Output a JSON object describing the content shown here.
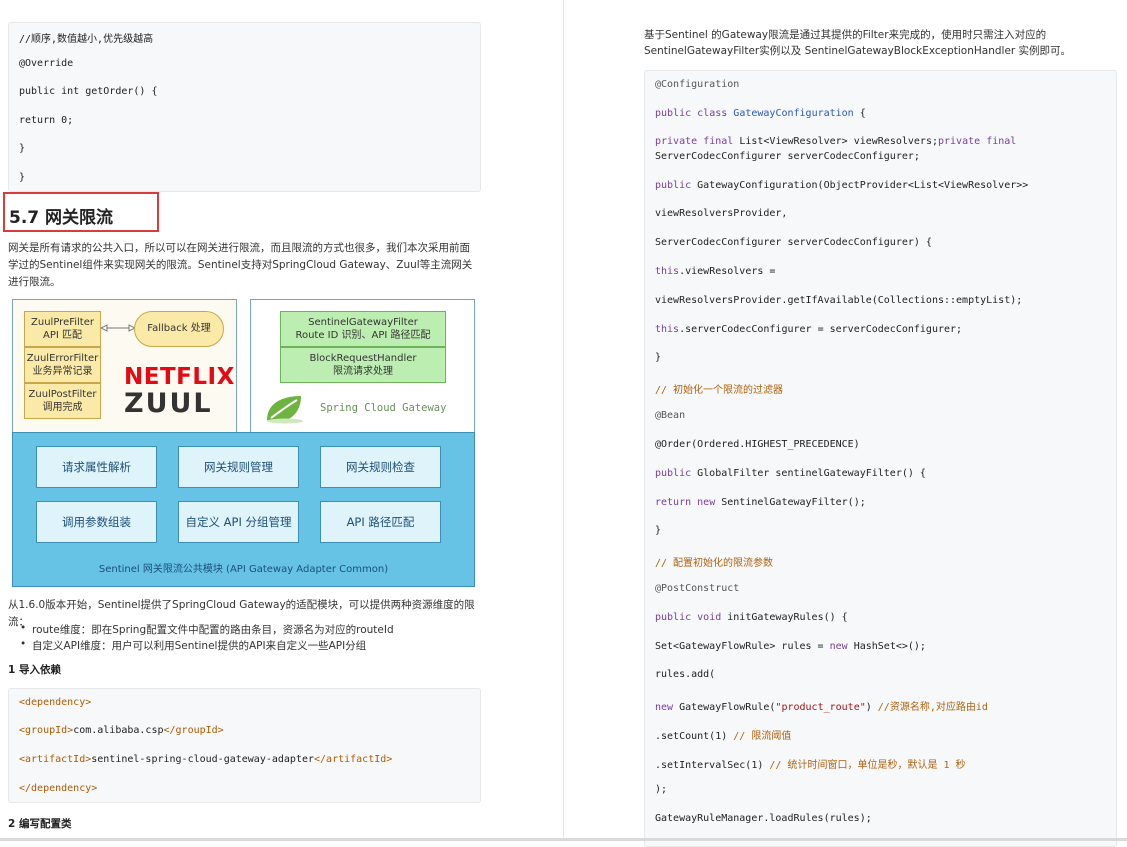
{
  "left": {
    "top_code": [
      {
        "text": "//顺序,数值越小,优先级越高",
        "cls": "cm"
      },
      {
        "text": "@Override",
        "cls": "an"
      },
      {
        "text": "public int getOrder() {",
        "cls": ""
      },
      {
        "text": "return 0;",
        "cls": ""
      },
      {
        "text": "}",
        "cls": ""
      },
      {
        "text": "}",
        "cls": ""
      }
    ],
    "heading": "5.7 网关限流",
    "intro": "网关是所有请求的公共入口，所以可以在网关进行限流，而且限流的方式也很多，我们本次采用前面学过的Sentinel组件来实现网关的限流。Sentinel支持对SpringCloud Gateway、Zuul等主流网关进行限流。",
    "diagram": {
      "zuul_filters": [
        {
          "line1": "ZuulPreFilter",
          "line2": "API 匹配"
        },
        {
          "line1": "ZuulErrorFilter",
          "line2": "业务异常记录"
        },
        {
          "line1": "ZuulPostFilter",
          "line2": "调用完成"
        }
      ],
      "fallback": "Fallback 处理",
      "netflix": "NETFLIX",
      "zuul": "ZUUL",
      "gateway_filters": [
        {
          "line1": "SentinelGatewayFilter",
          "line2": "Route ID 识别、API 路径匹配"
        },
        {
          "line1": "BlockRequestHandler",
          "line2": "限流请求处理"
        }
      ],
      "scg_logo": "Spring Cloud Gateway",
      "common_modules": [
        "请求属性解析",
        "网关规则管理",
        "网关规则检查",
        "调用参数组装",
        "自定义 API 分组管理",
        "API 路径匹配"
      ],
      "common_label": "Sentinel 网关限流公共模块 (API Gateway Adapter Common)"
    },
    "after_diagram": "从1.6.0版本开始，Sentinel提供了SpringCloud Gateway的适配模块，可以提供两种资源维度的限流：",
    "bullets": [
      "route维度：即在Spring配置文件中配置的路由条目，资源名为对应的routeId",
      "自定义API维度：用户可以利用Sentinel提供的API来自定义一些API分组"
    ],
    "step1": "1 导入依赖",
    "dependency_code": [
      {
        "text": "<dependency>",
        "cls": "tag"
      },
      {
        "text": "<groupId>com.alibaba.csp</groupId>",
        "cls": ""
      },
      {
        "text": "<artifactId>sentinel-spring-cloud-gateway-adapter</artifactId>",
        "cls": ""
      },
      {
        "text": "</dependency>",
        "cls": "tag"
      }
    ],
    "step2": "2 编写配置类"
  },
  "right": {
    "intro_line1": "基于Sentinel 的Gateway限流是通过其提供的Filter来完成的，使用时只需注入对应的",
    "intro_line2": "SentinelGatewayFilter实例以及 SentinelGatewayBlockExceptionHandler 实例即可。",
    "code": [
      {
        "text": "@Configuration",
        "cls": "an"
      },
      {
        "text": "public class GatewayConfiguration {",
        "cls": ""
      },
      {
        "text": "private final List<ViewResolver> viewResolvers;private final",
        "cls": ""
      },
      {
        "text": "ServerCodecConfigurer serverCodecConfigurer;",
        "cls": ""
      },
      {
        "text": "public GatewayConfiguration(ObjectProvider<List<ViewResolver>>",
        "cls": ""
      },
      {
        "text": "viewResolversProvider,",
        "cls": ""
      },
      {
        "text": "ServerCodecConfigurer serverCodecConfigurer) {",
        "cls": ""
      },
      {
        "text": "this.viewResolvers =",
        "cls": ""
      },
      {
        "text": "viewResolversProvider.getIfAvailable(Collections::emptyList);",
        "cls": ""
      },
      {
        "text": "this.serverCodecConfigurer = serverCodecConfigurer;",
        "cls": ""
      },
      {
        "text": "}",
        "cls": ""
      },
      {
        "text": "// 初始化一个限流的过滤器",
        "cls": "cm"
      },
      {
        "text": "@Bean",
        "cls": "an"
      },
      {
        "text": "@Order(Ordered.HIGHEST_PRECEDENCE)",
        "cls": ""
      },
      {
        "text": "public GlobalFilter sentinelGatewayFilter() {",
        "cls": ""
      },
      {
        "text": "return new SentinelGatewayFilter();",
        "cls": ""
      },
      {
        "text": "}",
        "cls": ""
      },
      {
        "text": "// 配置初始化的限流参数",
        "cls": "cm"
      },
      {
        "text": "@PostConstruct",
        "cls": "an"
      },
      {
        "text": "public void initGatewayRules() {",
        "cls": ""
      },
      {
        "text": "Set<GatewayFlowRule> rules = new HashSet<>();",
        "cls": ""
      },
      {
        "text": "rules.add(",
        "cls": ""
      },
      {
        "text": "new GatewayFlowRule(\"product_route\") //资源名称,对应路由id",
        "cls": ""
      },
      {
        "text": ".setCount(1) // 限流阈值",
        "cls": ""
      },
      {
        "text": ".setIntervalSec(1) // 统计时间窗口，单位是秒，默认是 1 秒",
        "cls": ""
      },
      {
        "text": ");",
        "cls": ""
      },
      {
        "text": "GatewayRuleManager.loadRules(rules);",
        "cls": ""
      }
    ]
  }
}
